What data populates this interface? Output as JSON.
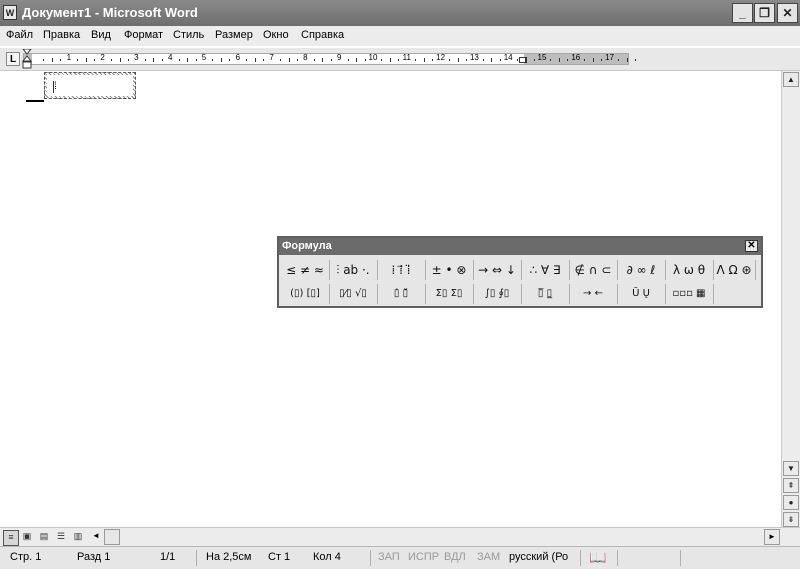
{
  "window": {
    "title": "Документ1 - Microsoft Word",
    "icon": "word-doc-icon",
    "buttons": {
      "minimize": "_",
      "restore": "❐",
      "close": "✕"
    }
  },
  "menubar": [
    "Файл",
    "Правка",
    "Вид",
    "Формат",
    "Стиль",
    "Размер",
    "Окно",
    "Справка"
  ],
  "ruler": {
    "tab_selector": "L",
    "numbers": [
      "1",
      "2",
      "3",
      "4",
      "5",
      "6",
      "7",
      "8",
      "9",
      "10",
      "11",
      "12",
      "13",
      "14",
      "15",
      "16",
      "17"
    ]
  },
  "editor": {
    "formula_placeholder": "⁞"
  },
  "formula_palette": {
    "title": "Формула",
    "close": "✕",
    "row1": [
      "≤ ≠ ≈",
      "⫶ ab ·.",
      "⁞ ⁞⃗ ⁞̈",
      "± • ⊗",
      "→ ⇔ ↓",
      "∴ ∀ ∃",
      "∉ ∩ ⊂",
      "∂ ∞ ℓ",
      "λ ω θ",
      "Λ Ω ⊛"
    ],
    "row2": [
      "(▯) [▯]",
      "▯⁄▯ √▯",
      "▯̇ ▯̆",
      "Σ▯ Σ▯",
      "∫▯ ∮▯",
      "▯̅ ▯̲",
      "→ ←",
      "Ū Ų",
      "▫▫▫ ▦"
    ]
  },
  "scrollbars": {
    "up": "▲",
    "down": "▼",
    "prev_page": "⇞",
    "select_object": "●",
    "next_page": "⇟",
    "left": "◄",
    "right": "►"
  },
  "view_buttons": [
    "normal-view-icon",
    "web-view-icon",
    "print-view-icon",
    "outline-view-icon",
    "reading-view-icon"
  ],
  "statusbar": {
    "page": "Стр. 1",
    "section": "Разд 1",
    "pages": "1/1",
    "at": "На 2,5см",
    "line": "Ст 1",
    "column": "Кол 4",
    "rec": "ЗАП",
    "trk": "ИСПР",
    "ext": "ВДЛ",
    "ovr": "ЗАМ",
    "language": "русский (Ро",
    "book_icon": "spelling-book-icon"
  }
}
